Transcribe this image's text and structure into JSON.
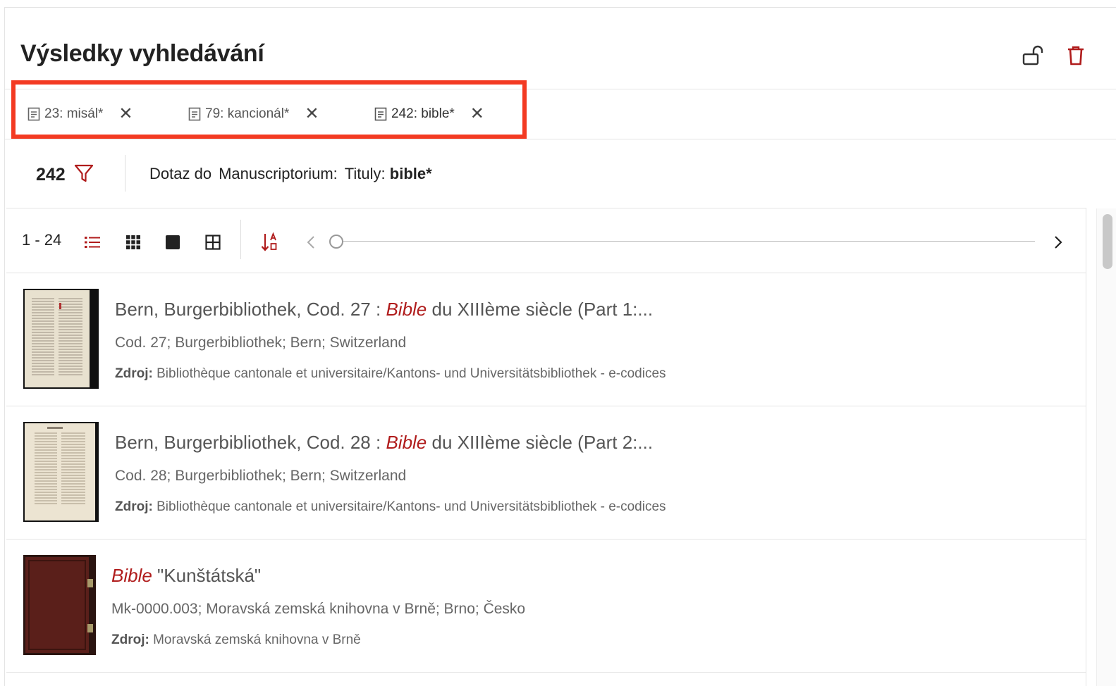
{
  "page": {
    "title": "Výsledky vyhledávání"
  },
  "header_icons": {
    "lock": "unlock-icon",
    "delete": "trash-icon"
  },
  "tabs": [
    {
      "label": "23: misál*",
      "close": "✕"
    },
    {
      "label": "79: kancionál*",
      "close": "✕"
    },
    {
      "label": "242: bible*",
      "close": "✕",
      "active": true
    }
  ],
  "query": {
    "count": "242",
    "prefix": "Dotaz do",
    "collection": "Manuscriptorium:",
    "field": "Tituly:",
    "term": "bible*"
  },
  "toolbar": {
    "range": "1 - 24"
  },
  "results": [
    {
      "title_prefix": "Bern, Burgerbibliothek, Cod. 27 : ",
      "title_highlight": "Bible",
      "title_suffix": " du XIIIème siècle (Part 1:...",
      "subtitle": "Cod. 27; Burgerbibliothek; Bern; Switzerland",
      "source_label": "Zdroj:",
      "source": "Bibliothèque cantonale et universitaire/Kantons- und Universitätsbibliothek - e-codices"
    },
    {
      "title_prefix": "Bern, Burgerbibliothek, Cod. 28 : ",
      "title_highlight": "Bible",
      "title_suffix": " du XIIIème siècle (Part 2:...",
      "subtitle": "Cod. 28; Burgerbibliothek; Bern; Switzerland",
      "source_label": "Zdroj:",
      "source": "Bibliothèque cantonale et universitaire/Kantons- und Universitätsbibliothek - e-codices"
    },
    {
      "title_prefix": "",
      "title_highlight": "Bible",
      "title_suffix": " \"Kunštátská\"",
      "subtitle": "Mk-0000.003; Moravská zemská knihovna v Brně; Brno; Česko",
      "source_label": "Zdroj:",
      "source": "Moravská zemská knihovna v Brně"
    }
  ],
  "colors": {
    "accent": "#b01c1c",
    "highlight_box": "#f33a22"
  }
}
